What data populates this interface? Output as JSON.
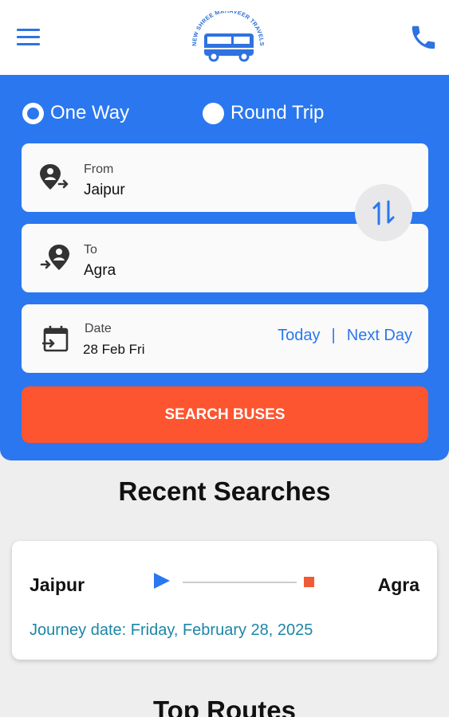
{
  "header": {
    "logo_text": "NEW SHREE MAHAVEER TRAVELS",
    "icons": {
      "menu": "hamburger-menu-icon",
      "phone": "phone-icon",
      "logo": "bus-logo"
    }
  },
  "search_form": {
    "trip_types": [
      {
        "label": "One Way",
        "selected": true
      },
      {
        "label": "Round Trip",
        "selected": false
      }
    ],
    "from": {
      "caption": "From",
      "value": "Jaipur",
      "icon": "departure-location-icon"
    },
    "to": {
      "caption": "To",
      "value": "Agra",
      "icon": "arrival-location-icon"
    },
    "date": {
      "caption": "Date",
      "value": "28 Feb Fri",
      "icon": "calendar-icon",
      "today_label": "Today",
      "separator": "|",
      "next_day_label": "Next Day"
    },
    "swap_icon": "swap-vertical-icon",
    "search_button_label": "SEARCH BUSES"
  },
  "recent_searches": {
    "title": "Recent Searches",
    "items": [
      {
        "from": "Jaipur",
        "to": "Agra",
        "journey_date": "Journey date: Friday, February 28, 2025"
      }
    ]
  },
  "top_routes": {
    "title": "Top Routes"
  },
  "colors": {
    "primary_blue": "#2a77f0",
    "search_button": "#fc5530",
    "link_blue": "#2a77f0",
    "journey_date_text": "#1c86a8",
    "background": "#eeeeee"
  }
}
